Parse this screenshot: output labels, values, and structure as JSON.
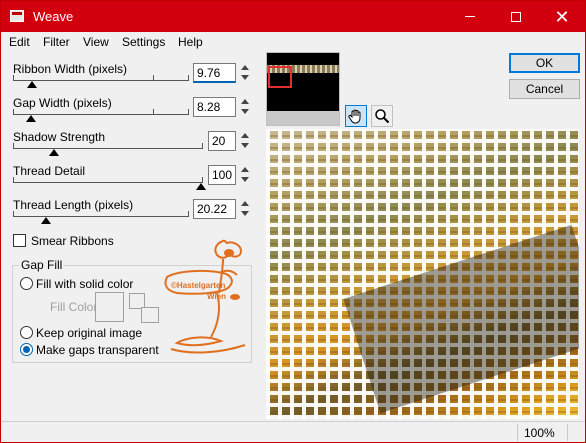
{
  "window": {
    "title": "Weave"
  },
  "menu": [
    "Edit",
    "Filter",
    "View",
    "Settings",
    "Help"
  ],
  "controls": {
    "ribbon_width": {
      "label": "Ribbon Width (pixels)",
      "value": "9.76"
    },
    "gap_width": {
      "label": "Gap Width (pixels)",
      "value": "8.28"
    },
    "shadow_strength": {
      "label": "Shadow Strength",
      "value": "20"
    },
    "thread_detail": {
      "label": "Thread Detail",
      "value": "100"
    },
    "thread_length": {
      "label": "Thread Length (pixels)",
      "value": "20.22"
    },
    "smear_ribbons": {
      "label": "Smear Ribbons",
      "checked": false
    }
  },
  "gap_fill": {
    "title": "Gap Fill",
    "fill_solid": "Fill with solid color",
    "fill_color": "Fill Color",
    "keep_original": "Keep original image",
    "transparent": "Make gaps transparent",
    "selected": "transparent"
  },
  "watermark": {
    "line1": "©Hastelgarten",
    "line2": "Wien"
  },
  "buttons": {
    "ok": "OK",
    "cancel": "Cancel"
  },
  "tools": {
    "pan": "hand-icon",
    "zoom": "magnifier-icon"
  },
  "status": {
    "zoom": "100%"
  },
  "colors": {
    "titlebar": "#d2000e",
    "accent": "#0078d7",
    "watermark": "#e07020"
  }
}
